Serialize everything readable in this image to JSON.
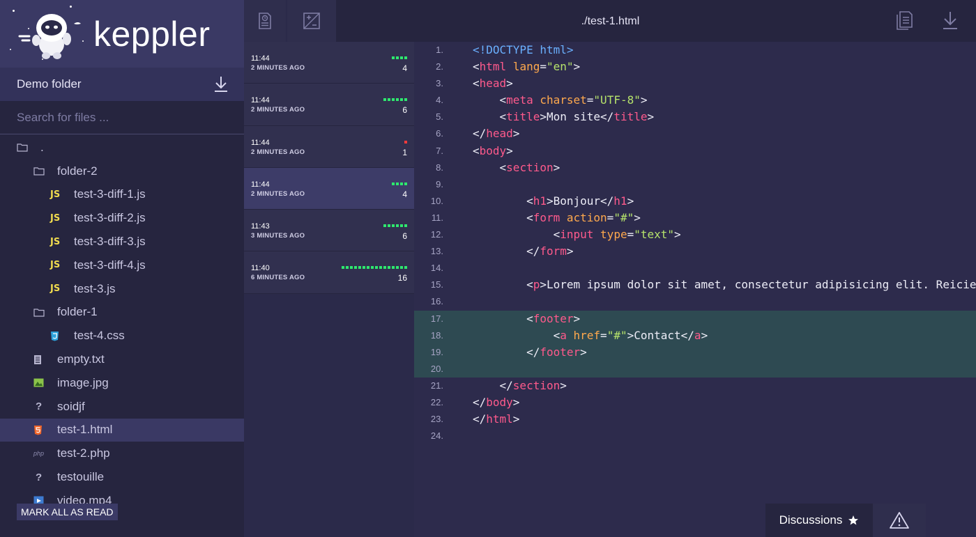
{
  "brand": {
    "name": "keppler"
  },
  "sidebar": {
    "folder_title": "Demo folder",
    "search_placeholder": "Search for files ...",
    "tree": [
      {
        "label": ".",
        "icon": "folder-icon",
        "depth": 0
      },
      {
        "label": "folder-2",
        "icon": "folder-icon",
        "depth": 1
      },
      {
        "label": "test-3-diff-1.js",
        "icon": "js-file-icon",
        "badge": "JS",
        "depth": 2
      },
      {
        "label": "test-3-diff-2.js",
        "icon": "js-file-icon",
        "badge": "JS",
        "depth": 2
      },
      {
        "label": "test-3-diff-3.js",
        "icon": "js-file-icon",
        "badge": "JS",
        "depth": 2
      },
      {
        "label": "test-3-diff-4.js",
        "icon": "js-file-icon",
        "badge": "JS",
        "depth": 2
      },
      {
        "label": "test-3.js",
        "icon": "js-file-icon",
        "badge": "JS",
        "depth": 2
      },
      {
        "label": "folder-1",
        "icon": "folder-icon",
        "depth": 1
      },
      {
        "label": "test-4.css",
        "icon": "css-file-icon",
        "depth": 2
      },
      {
        "label": "empty.txt",
        "icon": "text-file-icon",
        "depth": 1
      },
      {
        "label": "image.jpg",
        "icon": "image-file-icon",
        "depth": 1
      },
      {
        "label": "soidjf",
        "icon": "unknown-file-icon",
        "badge": "?",
        "depth": 1
      },
      {
        "label": "test-1.html",
        "icon": "html-file-icon",
        "depth": 1,
        "active": true
      },
      {
        "label": "test-2.php",
        "icon": "php-file-icon",
        "badge": "php",
        "depth": 1
      },
      {
        "label": "testouille",
        "icon": "unknown-file-icon",
        "badge": "?",
        "depth": 1
      },
      {
        "label": "video.mp4",
        "icon": "video-file-icon",
        "depth": 1
      }
    ],
    "mark_all_label": "MARK ALL AS READ"
  },
  "revisions": [
    {
      "time": "11:44",
      "ago": "2 MINUTES AGO",
      "count": "4",
      "added": 4,
      "removed": 0,
      "active": false
    },
    {
      "time": "11:44",
      "ago": "2 MINUTES AGO",
      "count": "6",
      "added": 6,
      "removed": 0,
      "active": false
    },
    {
      "time": "11:44",
      "ago": "2 MINUTES AGO",
      "count": "1",
      "added": 0,
      "removed": 1,
      "active": false
    },
    {
      "time": "11:44",
      "ago": "2 MINUTES AGO",
      "count": "4",
      "added": 4,
      "removed": 0,
      "active": true
    },
    {
      "time": "11:43",
      "ago": "3 MINUTES AGO",
      "count": "6",
      "added": 6,
      "removed": 0,
      "active": false
    },
    {
      "time": "11:40",
      "ago": "6 MINUTES AGO",
      "count": "16",
      "added": 16,
      "removed": 0,
      "active": false
    }
  ],
  "editor": {
    "file_path": "./test-1.html",
    "highlighted_lines": [
      17,
      18,
      19,
      20
    ],
    "lines": [
      [
        [
          "<!DOCTYPE html>",
          "d"
        ]
      ],
      [
        [
          "<",
          "p"
        ],
        [
          "html",
          "t"
        ],
        [
          " ",
          "p"
        ],
        [
          "lang",
          "a"
        ],
        [
          "=",
          "p"
        ],
        [
          "\"en\"",
          "s"
        ],
        [
          ">",
          "p"
        ]
      ],
      [
        [
          "<",
          "p"
        ],
        [
          "head",
          "t"
        ],
        [
          ">",
          "p"
        ]
      ],
      [
        [
          "    <",
          "p"
        ],
        [
          "meta",
          "t"
        ],
        [
          " ",
          "p"
        ],
        [
          "charset",
          "a"
        ],
        [
          "=",
          "p"
        ],
        [
          "\"UTF-8\"",
          "s"
        ],
        [
          ">",
          "p"
        ]
      ],
      [
        [
          "    <",
          "p"
        ],
        [
          "title",
          "t"
        ],
        [
          ">Mon site</",
          "p"
        ],
        [
          "title",
          "t"
        ],
        [
          ">",
          "p"
        ]
      ],
      [
        [
          "</",
          "p"
        ],
        [
          "head",
          "t"
        ],
        [
          ">",
          "p"
        ]
      ],
      [
        [
          "<",
          "p"
        ],
        [
          "body",
          "t"
        ],
        [
          ">",
          "p"
        ]
      ],
      [
        [
          "    <",
          "p"
        ],
        [
          "section",
          "t"
        ],
        [
          ">",
          "p"
        ]
      ],
      [],
      [
        [
          "        <",
          "p"
        ],
        [
          "h1",
          "t"
        ],
        [
          ">Bonjour</",
          "p"
        ],
        [
          "h1",
          "t"
        ],
        [
          ">",
          "p"
        ]
      ],
      [
        [
          "        <",
          "p"
        ],
        [
          "form",
          "t"
        ],
        [
          " ",
          "p"
        ],
        [
          "action",
          "a"
        ],
        [
          "=",
          "p"
        ],
        [
          "\"#\"",
          "s"
        ],
        [
          ">",
          "p"
        ]
      ],
      [
        [
          "            <",
          "p"
        ],
        [
          "input",
          "t"
        ],
        [
          " ",
          "p"
        ],
        [
          "type",
          "a"
        ],
        [
          "=",
          "p"
        ],
        [
          "\"text\"",
          "s"
        ],
        [
          ">",
          "p"
        ]
      ],
      [
        [
          "        </",
          "p"
        ],
        [
          "form",
          "t"
        ],
        [
          ">",
          "p"
        ]
      ],
      [],
      [
        [
          "        <",
          "p"
        ],
        [
          "p",
          "t"
        ],
        [
          ">Lorem ipsum dolor sit amet, consectetur adipisicing elit. Reicie",
          "p"
        ]
      ],
      [],
      [
        [
          "        <",
          "p"
        ],
        [
          "footer",
          "t"
        ],
        [
          ">",
          "p"
        ]
      ],
      [
        [
          "            <",
          "p"
        ],
        [
          "a",
          "t"
        ],
        [
          " ",
          "p"
        ],
        [
          "href",
          "a"
        ],
        [
          "=",
          "p"
        ],
        [
          "\"#\"",
          "s"
        ],
        [
          ">Contact</",
          "p"
        ],
        [
          "a",
          "t"
        ],
        [
          ">",
          "p"
        ]
      ],
      [
        [
          "        </",
          "p"
        ],
        [
          "footer",
          "t"
        ],
        [
          ">",
          "p"
        ]
      ],
      [],
      [
        [
          "    </",
          "p"
        ],
        [
          "section",
          "t"
        ],
        [
          ">",
          "p"
        ]
      ],
      [
        [
          "</",
          "p"
        ],
        [
          "body",
          "t"
        ],
        [
          ">",
          "p"
        ]
      ],
      [
        [
          "</",
          "p"
        ],
        [
          "html",
          "t"
        ],
        [
          ">",
          "p"
        ]
      ],
      []
    ]
  },
  "bottom": {
    "discussions_label": "Discussions"
  },
  "colors": {
    "added": "#2ee86e",
    "removed": "#ff3b3b",
    "tag": "#ff5a8c",
    "attr": "#ffa94d",
    "string": "#b6e36b",
    "doctype": "#6ab0ff",
    "highlight": "#2e4a52"
  }
}
